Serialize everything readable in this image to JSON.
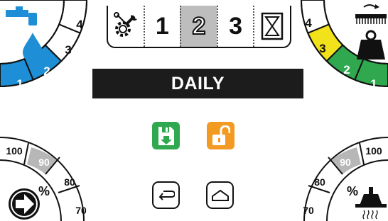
{
  "tabs": [
    {
      "id": "settings",
      "label": "",
      "icon": "gear-wrench-icon"
    },
    {
      "id": "p1",
      "label": "1"
    },
    {
      "id": "p2",
      "label": "2",
      "active": true
    },
    {
      "id": "p3",
      "label": "3"
    },
    {
      "id": "timer",
      "label": "",
      "icon": "hourglass-icon"
    }
  ],
  "banner": {
    "title": "DAILY"
  },
  "actions": {
    "save": {
      "icon": "floppy-disk-save-icon",
      "color": "#2fa84f"
    },
    "unlock": {
      "icon": "open-padlock-icon",
      "color": "#f39a22"
    }
  },
  "nav": {
    "back": {
      "icon": "return-arrow-icon"
    },
    "home": {
      "icon": "home-icon"
    }
  },
  "dials": {
    "water": {
      "icon": "faucet-water-drop-icon",
      "labels": [
        "4",
        "3",
        "2",
        "1"
      ],
      "active_level": 2,
      "color": "#1e8fd6"
    },
    "brush_weight": {
      "icon": "rotating-brush-weight-icon",
      "labels": [
        "4",
        "3",
        "2",
        "1"
      ],
      "level_colors": [
        "#ffffff",
        "#f2e21b",
        "#2fa84f",
        "#2fa84f"
      ]
    },
    "drive_speed": {
      "icon": "forward-arrow-circle-icon",
      "unit": "%",
      "labels": [
        "100",
        "90",
        "80",
        "70"
      ],
      "highlighted": "90"
    },
    "vacuum": {
      "icon": "vacuum-suction-icon",
      "unit": "%",
      "labels": [
        "100",
        "90",
        "80",
        "70"
      ],
      "highlighted": "90"
    }
  }
}
